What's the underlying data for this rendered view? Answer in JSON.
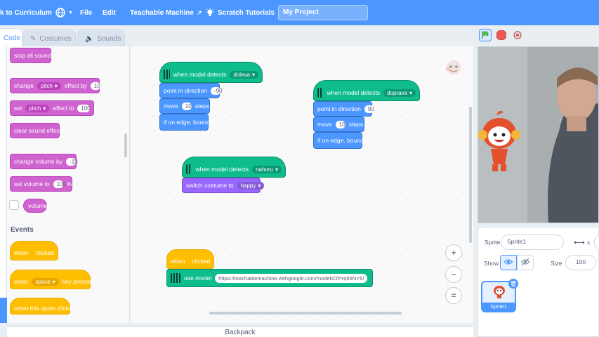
{
  "menu": {
    "back": "k to Curriculum",
    "file": "File",
    "edit": "Edit",
    "teachable": "Teachable Machine",
    "tutorials": "Scratch Tutorials",
    "project_title": "My Project"
  },
  "tabs": {
    "code": "Code",
    "costumes": "Costumes",
    "sounds": "Sounds"
  },
  "palette": {
    "stop_all_sounds": "stop all sounds",
    "change_word": "change",
    "pitch": "pitch",
    "effect_by": "effect by",
    "effect_by_value": "10",
    "set_word": "set",
    "effect_to": "effect to",
    "effect_to_value": "100",
    "clear_sound_effects": "clear sound effects",
    "change_volume_by": "change volume by",
    "change_volume_value": "-10",
    "set_volume_to": "set volume to",
    "set_volume_value": "100",
    "percent": "%",
    "volume_reporter": "volume",
    "events_title": "Events",
    "when": "when",
    "clicked": "clicked",
    "space": "space",
    "key_pressed": "key pressed",
    "when_sprite_clicked": "when this sprite clicked"
  },
  "scripts": {
    "when_model_detects": "when model detects",
    "s1_class": "doleva",
    "s1_direction_label": "point in direction",
    "s1_direction": "-90",
    "s1_move": "move",
    "s1_steps_value": "10",
    "s1_steps": "steps",
    "s1_bounce": "if on edge, bounce",
    "s2_class": "doprava",
    "s2_direction_label": "point in direction",
    "s2_direction": "90",
    "s2_move": "move",
    "s2_steps_value": "10",
    "s2_steps": "steps",
    "s2_bounce": "if on edge, bounce",
    "s3_class": "nahoru",
    "s3_costume_label": "switch costume to",
    "s3_costume": "happy",
    "s4_when": "when",
    "s4_clicked": "clicked",
    "s4_use_model": "use model",
    "s4_url": "https://teachablemachine.withgoogle.com/models/ZPrq96NY6/"
  },
  "zoom": {
    "in": "+",
    "out": "−",
    "reset": "="
  },
  "backpack": "Backpack",
  "sprite": {
    "sprite_label": "Sprite",
    "sprite_name": "Sprite1",
    "x_label": "x",
    "show_label": "Show",
    "size_label": "Size",
    "size_value": "100",
    "thumb_name": "Sprite1"
  },
  "colors": {
    "accent": "#4c97ff",
    "sound": "#cf63cf",
    "events": "#ffbf00",
    "motion": "#4c97ff",
    "looks": "#9966ff",
    "extension": "#0fbd8c"
  }
}
